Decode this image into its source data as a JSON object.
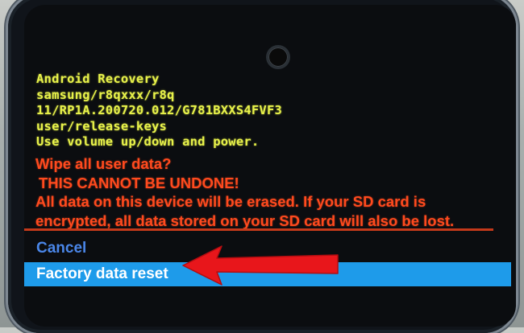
{
  "recovery": {
    "header_lines": [
      "Android Recovery",
      "samsung/r8qxxx/r8q",
      "11/RP1A.200720.012/G781BXXS4FVF3",
      "user/release-keys",
      "Use volume up/down and power."
    ],
    "warning": {
      "title": "Wipe all user data?",
      "emphasis": "THIS CANNOT BE UNDONE!",
      "line1": "All data on this device will be erased. If your SD card is",
      "line2": "encrypted, all data stored on your SD card will also be lost."
    },
    "menu": {
      "items": [
        {
          "label": "Cancel",
          "selected": false
        },
        {
          "label": "Factory data reset",
          "selected": true
        }
      ]
    }
  },
  "colors": {
    "header_text": "#e8f24a",
    "warning_text": "#ff4a1e",
    "cancel_text": "#4a86e8",
    "selection_bar": "#1e9bea",
    "annotation_arrow": "#e8161b"
  },
  "icons": {
    "front_camera": "front-camera-icon",
    "pointer": "red-arrow-icon"
  }
}
